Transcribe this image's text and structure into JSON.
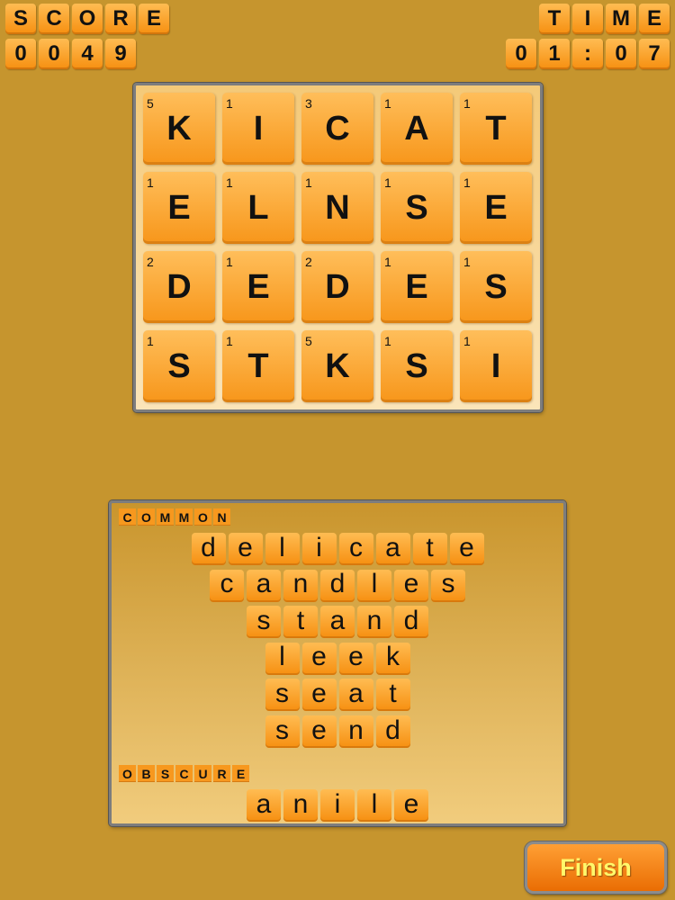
{
  "hud": {
    "score_label": "SCORE",
    "score_value": "0049",
    "time_label": "TIME",
    "time_value": "01:07"
  },
  "board": {
    "tiles": [
      {
        "letter": "K",
        "points": "5"
      },
      {
        "letter": "I",
        "points": "1"
      },
      {
        "letter": "C",
        "points": "3"
      },
      {
        "letter": "A",
        "points": "1"
      },
      {
        "letter": "T",
        "points": "1"
      },
      {
        "letter": "E",
        "points": "1"
      },
      {
        "letter": "L",
        "points": "1"
      },
      {
        "letter": "N",
        "points": "1"
      },
      {
        "letter": "S",
        "points": "1"
      },
      {
        "letter": "E",
        "points": "1"
      },
      {
        "letter": "D",
        "points": "2"
      },
      {
        "letter": "E",
        "points": "1"
      },
      {
        "letter": "D",
        "points": "2"
      },
      {
        "letter": "E",
        "points": "1"
      },
      {
        "letter": "S",
        "points": "1"
      },
      {
        "letter": "S",
        "points": "1"
      },
      {
        "letter": "T",
        "points": "1"
      },
      {
        "letter": "K",
        "points": "5"
      },
      {
        "letter": "S",
        "points": "1"
      },
      {
        "letter": "I",
        "points": "1"
      }
    ]
  },
  "found_words": {
    "common_label": "COMMON",
    "common": [
      "delicate",
      "candles",
      "stand",
      "leek",
      "seat",
      "send"
    ],
    "obscure_label": "OBSCURE",
    "obscure": [
      "anile"
    ]
  },
  "finish_label": "Finish",
  "colors": {
    "background": "#c6952e",
    "tile": "#f7961a",
    "finish_text": "#fff86b"
  }
}
